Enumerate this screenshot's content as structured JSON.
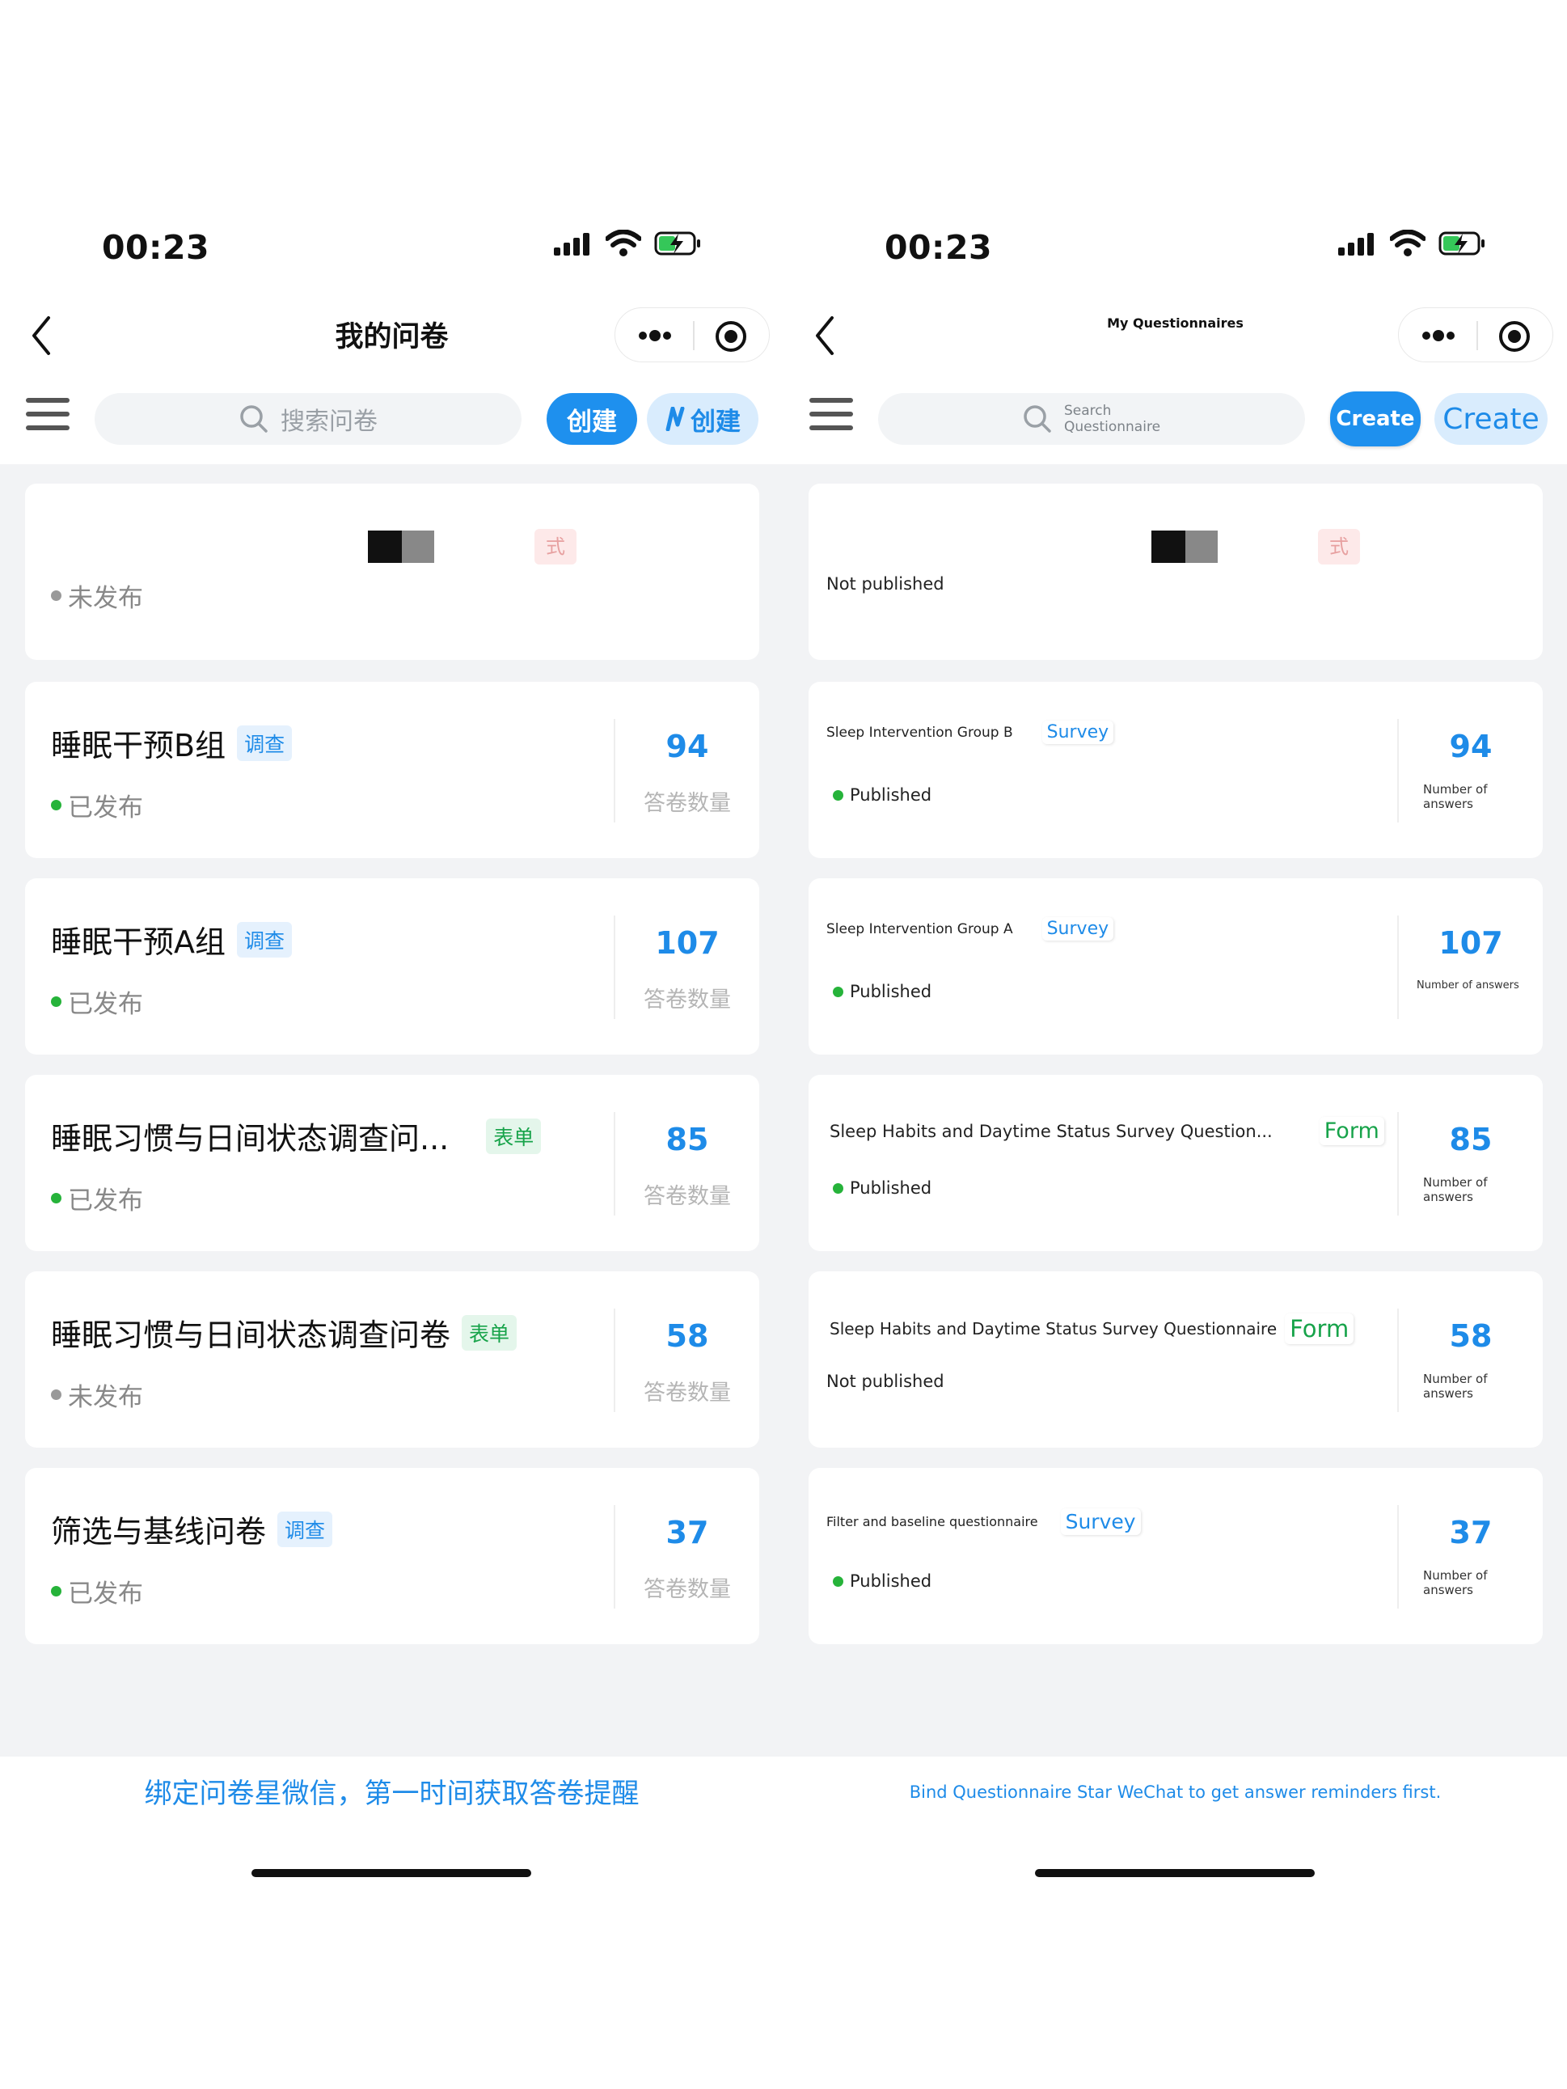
{
  "left": {
    "status_time": "00:23",
    "nav_title": "我的问卷",
    "search_placeholder": "搜索问卷",
    "create_label": "创建",
    "ai_create_label": "创建",
    "cards": [
      {
        "title": "",
        "tag": "",
        "status": "未发布",
        "count": "",
        "count_label": ""
      },
      {
        "title": "睡眠干预B组",
        "tag": "调查",
        "status": "已发布",
        "count": "94",
        "count_label": "答卷数量"
      },
      {
        "title": "睡眠干预A组",
        "tag": "调查",
        "status": "已发布",
        "count": "107",
        "count_label": "答卷数量"
      },
      {
        "title": "睡眠习惯与日间状态调查问...",
        "tag": "表单",
        "status": "已发布",
        "count": "85",
        "count_label": "答卷数量"
      },
      {
        "title": "睡眠习惯与日间状态调查问卷",
        "tag": "表单",
        "status": "未发布",
        "count": "58",
        "count_label": "答卷数量"
      },
      {
        "title": "筛选与基线问卷",
        "tag": "调查",
        "status": "已发布",
        "count": "37",
        "count_label": "答卷数量"
      }
    ],
    "footer_banner": "绑定问卷星微信，第一时间获取答卷提醒"
  },
  "right": {
    "status_time": "00:23",
    "nav_title": "My Questionnaires",
    "search_placeholder": "Search Questionnaire",
    "create_label": "Create",
    "ai_create_label": "Create",
    "cards": [
      {
        "title": "",
        "tag": "",
        "status": "Not published",
        "count": "",
        "count_label": ""
      },
      {
        "title": "Sleep Intervention Group B",
        "tag": "Survey",
        "status": "Published",
        "count": "94",
        "count_label": "Number of answers"
      },
      {
        "title": "Sleep Intervention Group A",
        "tag": "Survey",
        "status": "Published",
        "count": "107",
        "count_label": "Number of answers"
      },
      {
        "title": "Sleep Habits and Daytime Status Survey Question...",
        "tag": "Form",
        "status": "Published",
        "count": "85",
        "count_label": "Number of answers"
      },
      {
        "title": "Sleep Habits and Daytime Status Survey Questionnaire",
        "tag": "Form",
        "status": "Not published",
        "count": "58",
        "count_label": "Number of answers"
      },
      {
        "title": "Filter and baseline questionnaire",
        "tag": "Survey",
        "status": "Published",
        "count": "37",
        "count_label": "Number of answers"
      }
    ],
    "footer_banner": "Bind Questionnaire Star WeChat to get answer reminders first."
  },
  "icons": [
    "back-icon",
    "more-dots-icon",
    "target-icon",
    "menu-icon",
    "search-icon",
    "ai-n-icon",
    "signal-icon",
    "wifi-icon",
    "battery-charging-icon"
  ],
  "colors": {
    "accent": "#1e8be8",
    "published": "#26b33a",
    "unpublished": "#999999",
    "list_bg": "#f2f3f5"
  }
}
